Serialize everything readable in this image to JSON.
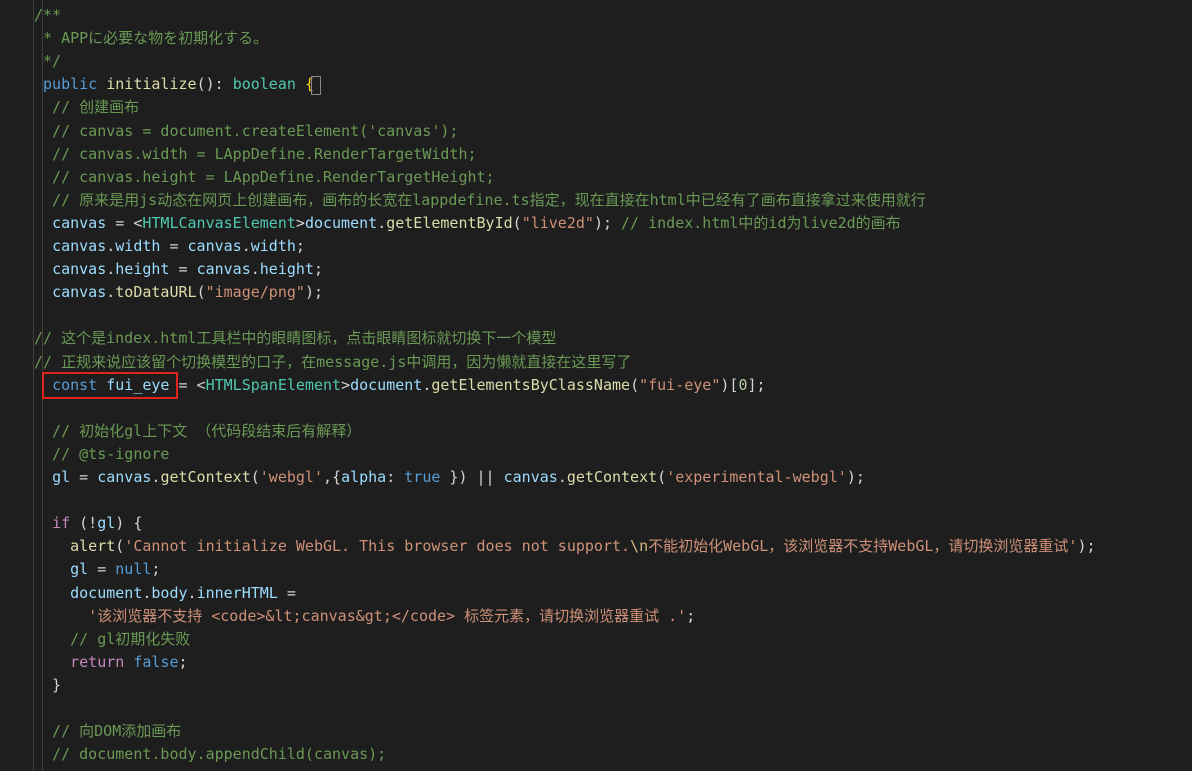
{
  "code_lines": [
    [
      {
        "t": "/**",
        "c": "comment"
      }
    ],
    [
      {
        "t": " * APPに必要な物を初期化する。",
        "c": "comment"
      }
    ],
    [
      {
        "t": " */",
        "c": "comment"
      }
    ],
    [
      {
        "t": " public",
        "c": "keyword"
      },
      {
        "t": " ",
        "c": "plain"
      },
      {
        "t": "initialize",
        "c": "func"
      },
      {
        "t": "(): ",
        "c": "plain"
      },
      {
        "t": "boolean",
        "c": "type"
      },
      {
        "t": " ",
        "c": "plain"
      },
      {
        "t": "{",
        "c": "bracket"
      }
    ],
    [
      {
        "t": "  // 创建画布",
        "c": "comment"
      }
    ],
    [
      {
        "t": "  // canvas = document.createElement('canvas');",
        "c": "comment"
      }
    ],
    [
      {
        "t": "  // canvas.width = LAppDefine.RenderTargetWidth;",
        "c": "comment"
      }
    ],
    [
      {
        "t": "  // canvas.height = LAppDefine.RenderTargetHeight;",
        "c": "comment"
      }
    ],
    [
      {
        "t": "  // 原来是用js动态在网页上创建画布，画布的长宽在lappdefine.ts指定，现在直接在html中已经有了画布直接拿过来使用就行",
        "c": "comment"
      }
    ],
    [
      {
        "t": "  ",
        "c": "plain"
      },
      {
        "t": "canvas",
        "c": "var"
      },
      {
        "t": " = <",
        "c": "plain"
      },
      {
        "t": "HTMLCanvasElement",
        "c": "type"
      },
      {
        "t": ">",
        "c": "plain"
      },
      {
        "t": "document",
        "c": "var"
      },
      {
        "t": ".",
        "c": "plain"
      },
      {
        "t": "getElementById",
        "c": "func"
      },
      {
        "t": "(",
        "c": "plain"
      },
      {
        "t": "\"live2d\"",
        "c": "string"
      },
      {
        "t": "); ",
        "c": "plain"
      },
      {
        "t": "// index.html中的id为live2d的画布",
        "c": "comment"
      }
    ],
    [
      {
        "t": "  ",
        "c": "plain"
      },
      {
        "t": "canvas",
        "c": "var"
      },
      {
        "t": ".",
        "c": "plain"
      },
      {
        "t": "width",
        "c": "var"
      },
      {
        "t": " = ",
        "c": "plain"
      },
      {
        "t": "canvas",
        "c": "var"
      },
      {
        "t": ".",
        "c": "plain"
      },
      {
        "t": "width",
        "c": "var"
      },
      {
        "t": ";",
        "c": "plain"
      }
    ],
    [
      {
        "t": "  ",
        "c": "plain"
      },
      {
        "t": "canvas",
        "c": "var"
      },
      {
        "t": ".",
        "c": "plain"
      },
      {
        "t": "height",
        "c": "var"
      },
      {
        "t": " = ",
        "c": "plain"
      },
      {
        "t": "canvas",
        "c": "var"
      },
      {
        "t": ".",
        "c": "plain"
      },
      {
        "t": "height",
        "c": "var"
      },
      {
        "t": ";",
        "c": "plain"
      }
    ],
    [
      {
        "t": "  ",
        "c": "plain"
      },
      {
        "t": "canvas",
        "c": "var"
      },
      {
        "t": ".",
        "c": "plain"
      },
      {
        "t": "toDataURL",
        "c": "func"
      },
      {
        "t": "(",
        "c": "plain"
      },
      {
        "t": "\"image/png\"",
        "c": "string"
      },
      {
        "t": ");",
        "c": "plain"
      }
    ],
    [],
    [
      {
        "t": "// 这个是index.html工具栏中的眼睛图标，点击眼睛图标就切换下一个模型",
        "c": "comment"
      }
    ],
    [
      {
        "t": "// 正规来说应该留个切换模型的口子，在message.js中调用，因为懒就直接在这里写了",
        "c": "comment"
      }
    ],
    [
      {
        "t": "  ",
        "c": "plain"
      },
      {
        "t": "const",
        "c": "keyword"
      },
      {
        "t": " ",
        "c": "plain"
      },
      {
        "t": "fui_eye",
        "c": "var"
      },
      {
        "t": " = <",
        "c": "plain"
      },
      {
        "t": "HTMLSpanElement",
        "c": "type"
      },
      {
        "t": ">",
        "c": "plain"
      },
      {
        "t": "document",
        "c": "var"
      },
      {
        "t": ".",
        "c": "plain"
      },
      {
        "t": "getElementsByClassName",
        "c": "func"
      },
      {
        "t": "(",
        "c": "plain"
      },
      {
        "t": "\"fui-eye\"",
        "c": "string"
      },
      {
        "t": ")[",
        "c": "plain"
      },
      {
        "t": "0",
        "c": "number"
      },
      {
        "t": "];",
        "c": "plain"
      }
    ],
    [],
    [
      {
        "t": "  // 初始化gl上下文 （代码段结束后有解释）",
        "c": "comment"
      }
    ],
    [
      {
        "t": "  // @ts-ignore",
        "c": "comment"
      }
    ],
    [
      {
        "t": "  ",
        "c": "plain"
      },
      {
        "t": "gl",
        "c": "var"
      },
      {
        "t": " = ",
        "c": "plain"
      },
      {
        "t": "canvas",
        "c": "var"
      },
      {
        "t": ".",
        "c": "plain"
      },
      {
        "t": "getContext",
        "c": "func"
      },
      {
        "t": "(",
        "c": "plain"
      },
      {
        "t": "'webgl'",
        "c": "string"
      },
      {
        "t": ",{",
        "c": "plain"
      },
      {
        "t": "alpha",
        "c": "var"
      },
      {
        "t": ": ",
        "c": "plain"
      },
      {
        "t": "true",
        "c": "keyword"
      },
      {
        "t": " }) || ",
        "c": "plain"
      },
      {
        "t": "canvas",
        "c": "var"
      },
      {
        "t": ".",
        "c": "plain"
      },
      {
        "t": "getContext",
        "c": "func"
      },
      {
        "t": "(",
        "c": "plain"
      },
      {
        "t": "'experimental-webgl'",
        "c": "string"
      },
      {
        "t": ");",
        "c": "plain"
      }
    ],
    [],
    [
      {
        "t": "  ",
        "c": "plain"
      },
      {
        "t": "if",
        "c": "control"
      },
      {
        "t": " (!",
        "c": "plain"
      },
      {
        "t": "gl",
        "c": "var"
      },
      {
        "t": ") {",
        "c": "plain"
      }
    ],
    [
      {
        "t": "    ",
        "c": "plain"
      },
      {
        "t": "alert",
        "c": "func"
      },
      {
        "t": "(",
        "c": "plain"
      },
      {
        "t": "'Cannot initialize WebGL. This browser does not support.",
        "c": "string"
      },
      {
        "t": "\\n",
        "c": "escape"
      },
      {
        "t": "不能初始化WebGL，该浏览器不支持WebGL，请切换浏览器重试'",
        "c": "string"
      },
      {
        "t": ");",
        "c": "plain"
      }
    ],
    [
      {
        "t": "    ",
        "c": "plain"
      },
      {
        "t": "gl",
        "c": "var"
      },
      {
        "t": " = ",
        "c": "plain"
      },
      {
        "t": "null",
        "c": "keyword"
      },
      {
        "t": ";",
        "c": "plain"
      }
    ],
    [
      {
        "t": "    ",
        "c": "plain"
      },
      {
        "t": "document",
        "c": "var"
      },
      {
        "t": ".",
        "c": "plain"
      },
      {
        "t": "body",
        "c": "var"
      },
      {
        "t": ".",
        "c": "plain"
      },
      {
        "t": "innerHTML",
        "c": "var"
      },
      {
        "t": " =",
        "c": "plain"
      }
    ],
    [
      {
        "t": "      ",
        "c": "plain"
      },
      {
        "t": "'该浏览器不支持 <code>&lt;canvas&gt;</code> 标签元素，请切换浏览器重试 .'",
        "c": "string"
      },
      {
        "t": ";",
        "c": "plain"
      }
    ],
    [
      {
        "t": "    // gl初期化失败",
        "c": "comment"
      }
    ],
    [
      {
        "t": "    ",
        "c": "plain"
      },
      {
        "t": "return",
        "c": "control"
      },
      {
        "t": " ",
        "c": "plain"
      },
      {
        "t": "false",
        "c": "keyword"
      },
      {
        "t": ";",
        "c": "plain"
      }
    ],
    [
      {
        "t": "  }",
        "c": "plain"
      }
    ],
    [],
    [
      {
        "t": "  // 向DOM添加画布",
        "c": "comment"
      }
    ],
    [
      {
        "t": "  // document.body.appendChild(canvas);",
        "c": "comment"
      }
    ]
  ]
}
